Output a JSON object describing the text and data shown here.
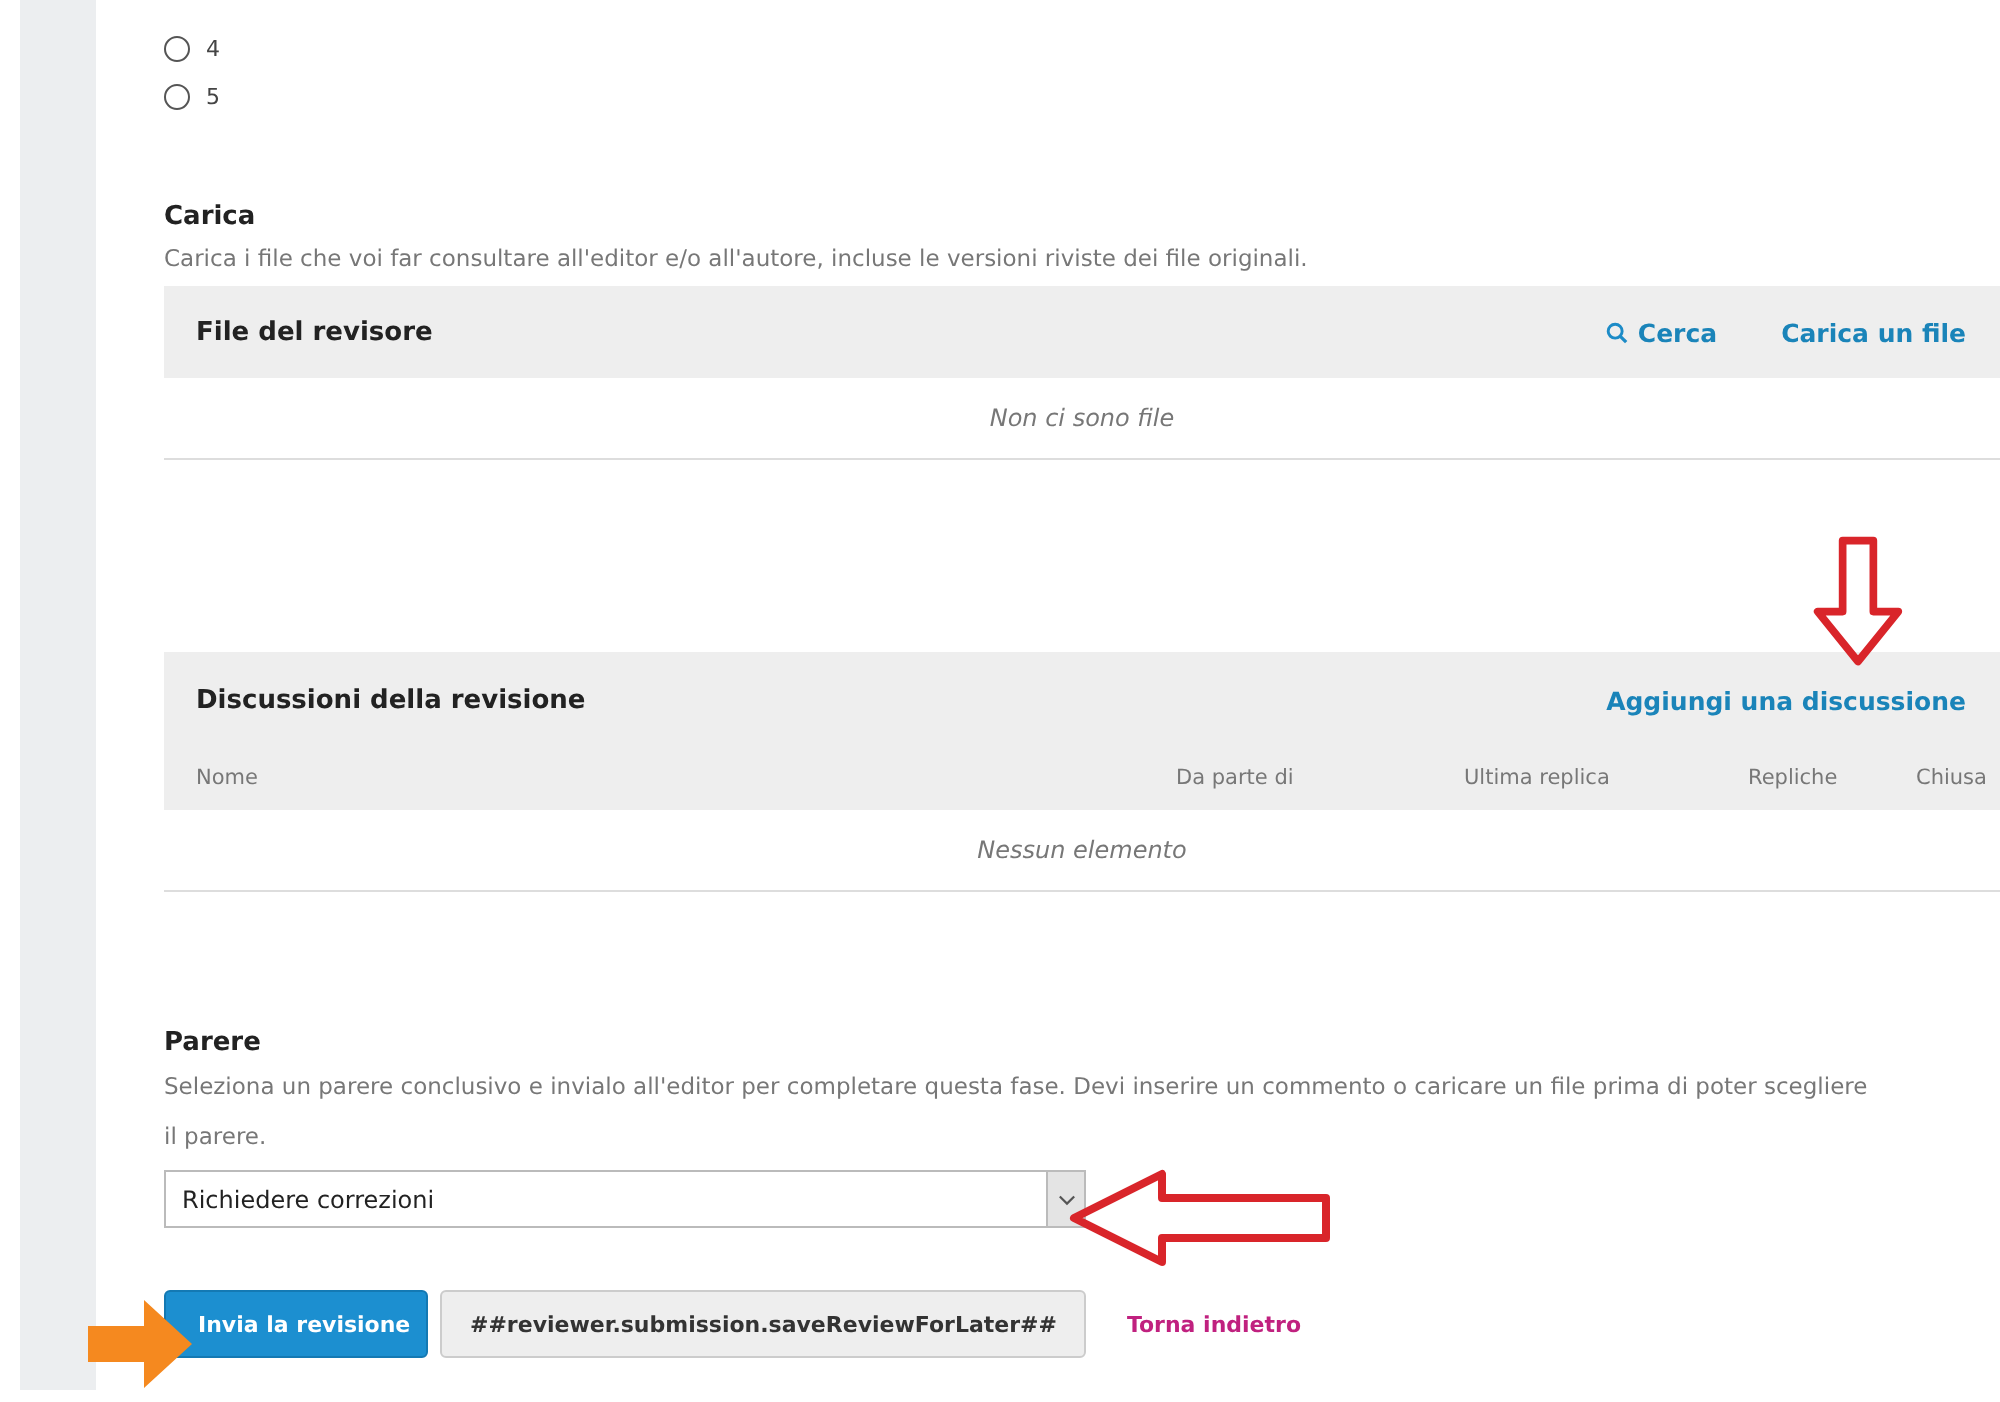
{
  "rating_options": [
    {
      "label": "4",
      "selected": false
    },
    {
      "label": "5",
      "selected": false
    }
  ],
  "upload": {
    "heading": "Carica",
    "description": "Carica i file che voi far consultare all'editor e/o all'autore, incluse le versioni riviste dei file originali.",
    "panel": {
      "title": "File del revisore",
      "actions": [
        {
          "label": "Cerca",
          "kind": "search"
        },
        {
          "label": "Carica un file"
        }
      ],
      "empty": "Non ci sono file"
    }
  },
  "discussions": {
    "title": "Discussioni della revisione",
    "action": "Aggiungi una discussione",
    "columns": [
      "Nome",
      "Da parte di",
      "Ultima replica",
      "Repliche",
      "Chiusa"
    ],
    "empty": "Nessun elemento"
  },
  "recommendation": {
    "heading": "Parere",
    "description": "Seleziona un parere conclusivo e invialo all'editor per completare questa fase. Devi inserire un commento o caricare un file prima di poter scegliere il parere.",
    "select_value": "Richiedere correzioni"
  },
  "buttons": [
    {
      "label": "Invia la revisione",
      "kind": "primary"
    },
    {
      "label": "##reviewer.submission.saveReviewForLater##",
      "kind": "secondary"
    },
    {
      "label": "Torna indietro",
      "kind": "link"
    }
  ]
}
